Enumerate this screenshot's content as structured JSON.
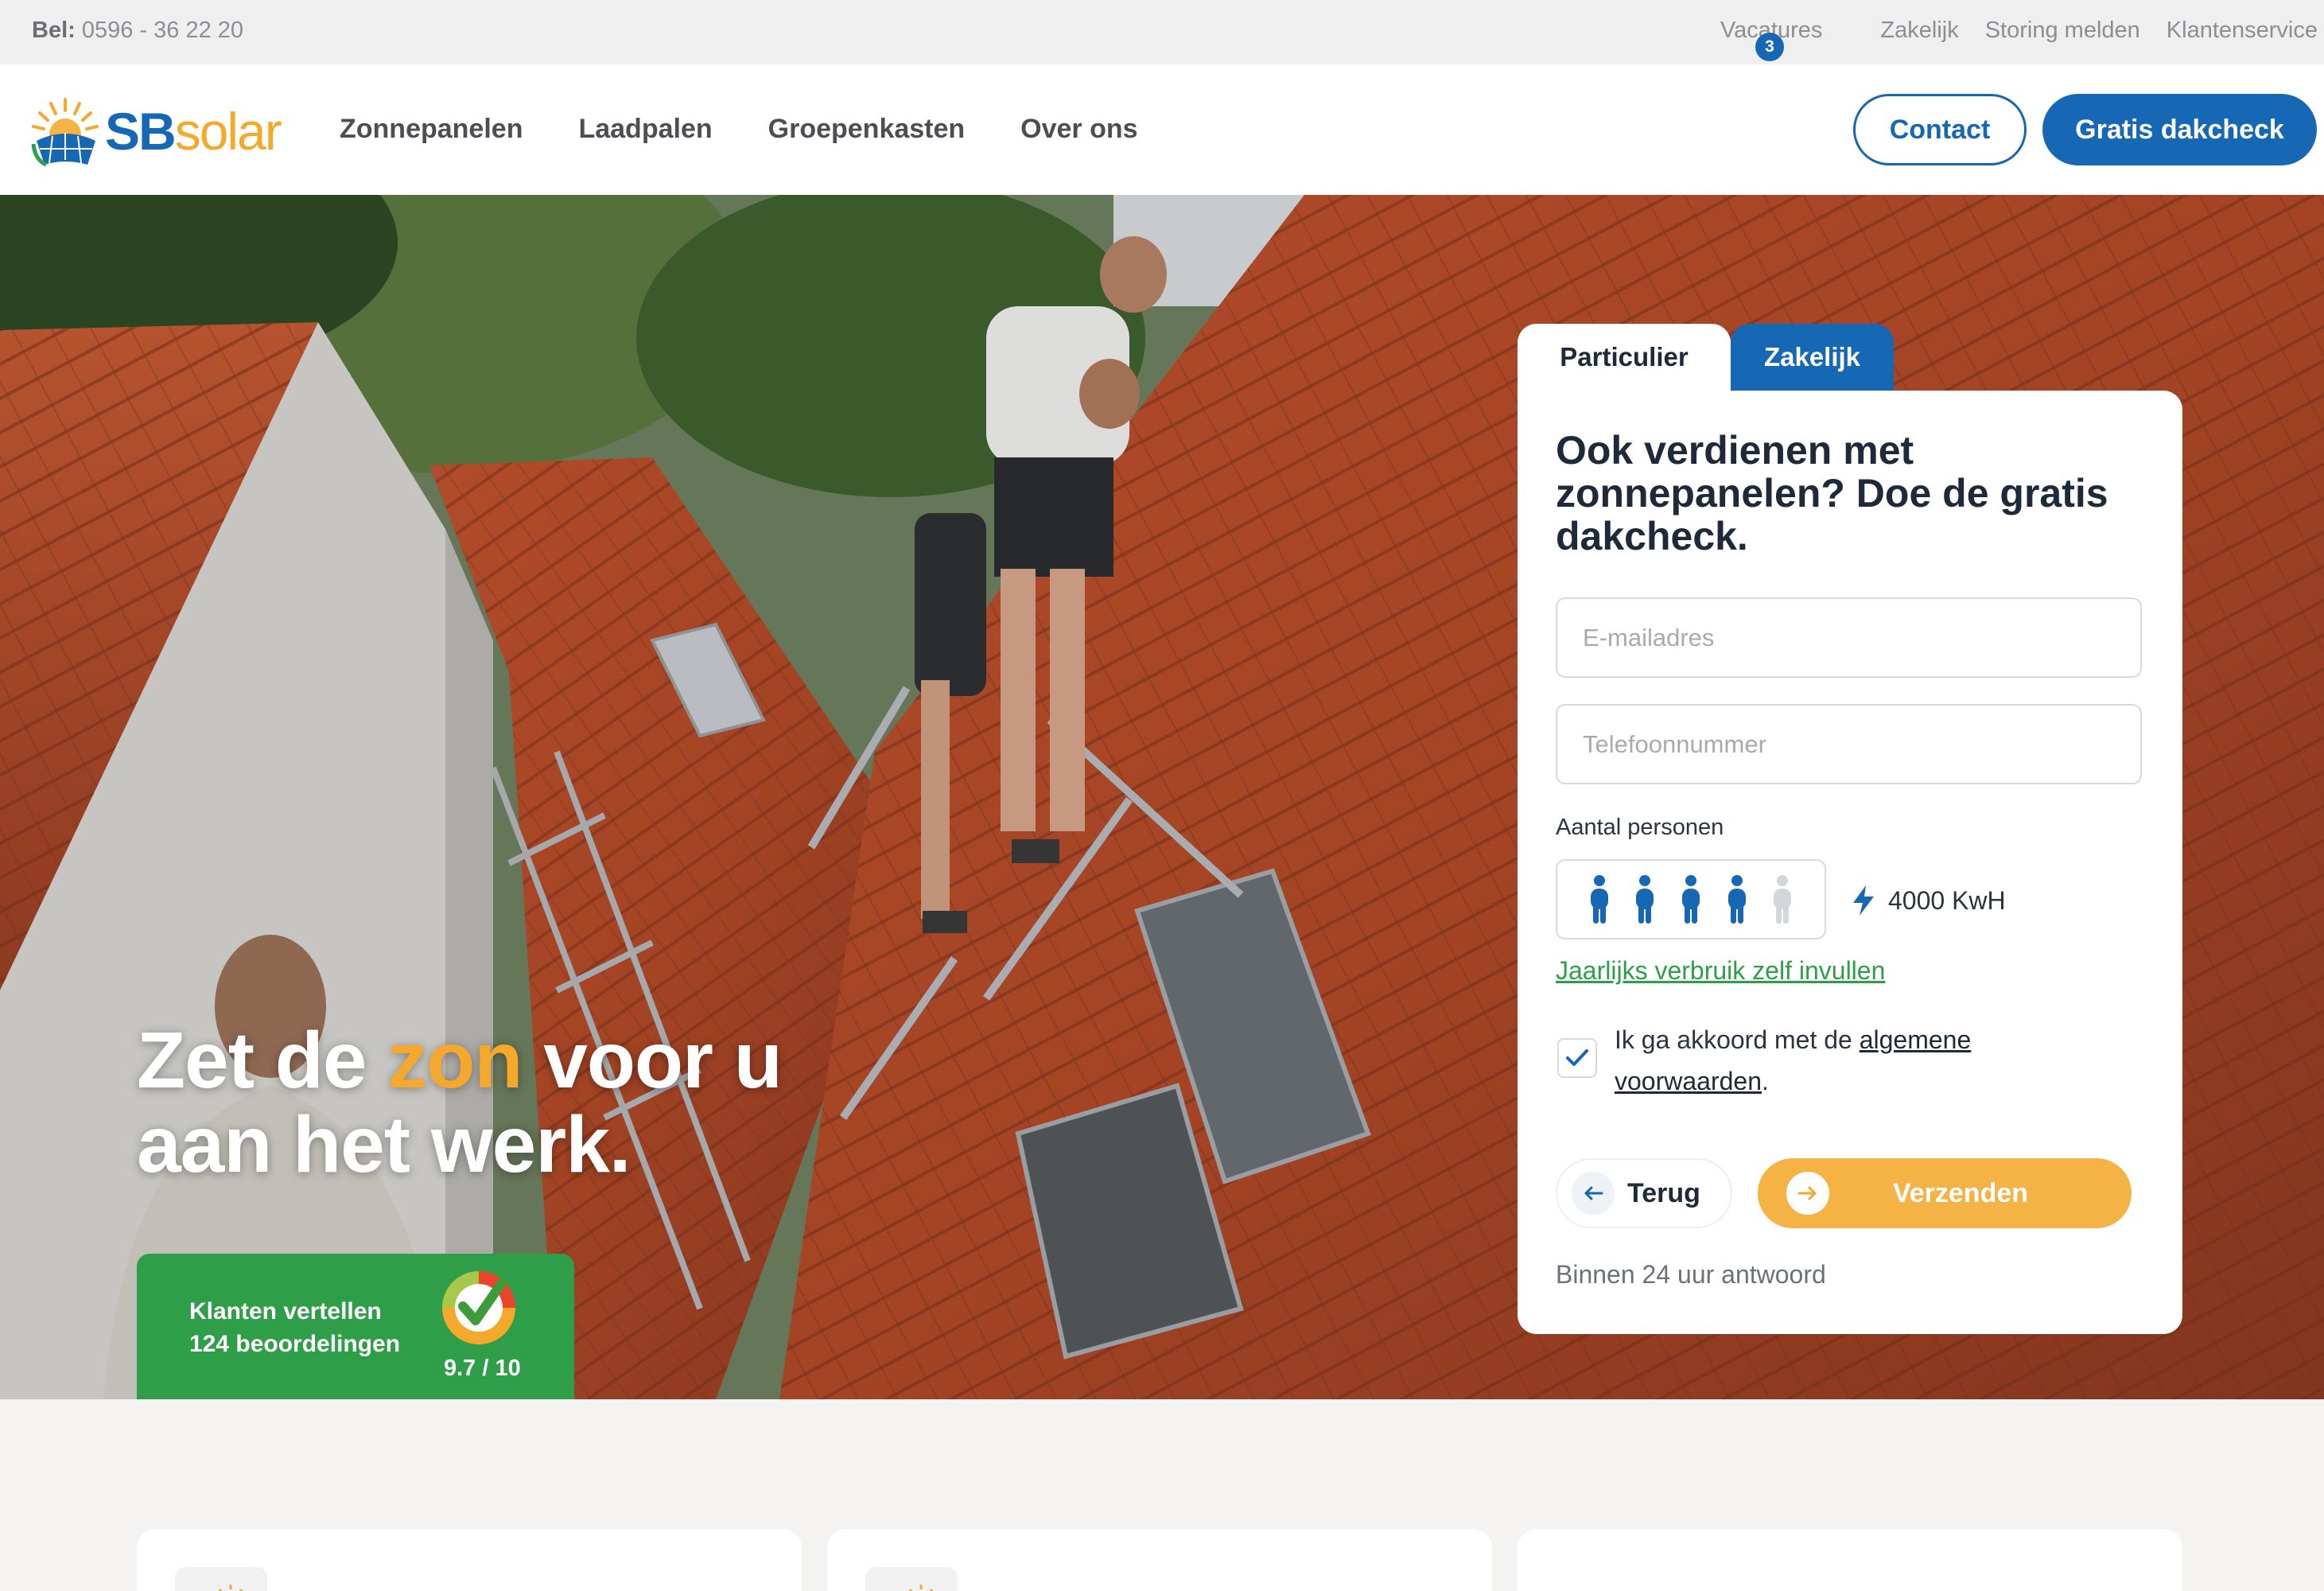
{
  "topbar": {
    "phone_label": "Bel:",
    "phone_number": "0596 - 36 22 20",
    "links": [
      "Vacatures",
      "Zakelijk",
      "Storing melden",
      "Klantenservice"
    ],
    "vacatures_badge": "3"
  },
  "header": {
    "logo": {
      "sb": "SB",
      "solar": "solar"
    },
    "nav": [
      "Zonnepanelen",
      "Laadpalen",
      "Groepenkasten",
      "Over ons"
    ],
    "contact_label": "Contact",
    "dakcheck_label": "Gratis dakcheck"
  },
  "hero": {
    "title_part1": "Zet de ",
    "title_accent": "zon",
    "title_part2": " voor u",
    "title_line2": "aan het werk.",
    "review": {
      "line1": "Klanten vertellen",
      "line2": "124 beoordelingen",
      "score": "9.7 / 10"
    }
  },
  "form": {
    "tabs": [
      "Particulier",
      "Zakelijk"
    ],
    "active_tab": "Particulier",
    "title": "Ook verdienen met zonnepanelen? Doe de gratis dakcheck.",
    "email_placeholder": "E-mailadres",
    "phone_placeholder": "Telefoonnummer",
    "persons_label": "Aantal personen",
    "persons_selected": 4,
    "persons_max": 5,
    "kwh_value": "4000 KwH",
    "manual_link": "Jaarlijks verbruik zelf invullen",
    "agree_text": "Ik ga akkoord met de ",
    "agree_link": "algemene voorwaarden",
    "agree_end": ".",
    "agree_checked": true,
    "back_label": "Terug",
    "send_label": "Verzenden",
    "response_note": "Binnen 24 uur antwoord"
  },
  "colors": {
    "brand_blue": "#1667b4",
    "brand_orange": "#f5a92c",
    "review_green": "#2f9e49"
  }
}
